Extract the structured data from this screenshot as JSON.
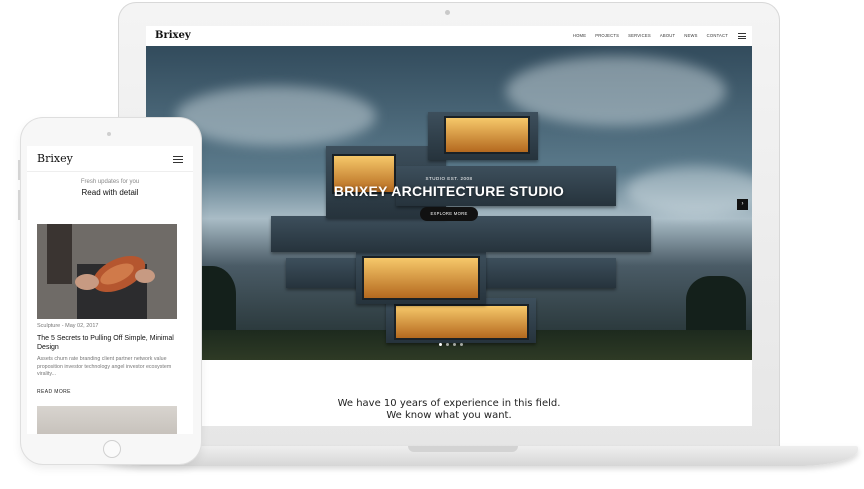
{
  "desktop": {
    "logo": "Brixey",
    "nav": [
      "HOME",
      "PROJECTS",
      "SERVICES",
      "ABOUT",
      "NEWS",
      "CONTACT"
    ],
    "hero": {
      "kicker": "STUDIO EST. 2008",
      "title": "BRIXEY ARCHITECTURE STUDIO",
      "button": "EXPLORE MORE",
      "arrow": "›"
    },
    "tagline_line1": "We have 10 years of experience in this field.",
    "tagline_line2": "We know what you want."
  },
  "mobile": {
    "logo": "Brixey",
    "sub": "Fresh updates for you",
    "heading": "Read with detail",
    "post": {
      "meta": "Sculpture - May 02, 2017",
      "title": "The 5 Secrets to Pulling Off Simple, Minimal Design",
      "excerpt": "Assets churn rate branding client partner network value proposition investor technology angel investor ecosystem virality...",
      "read_more": "READ MORE"
    }
  },
  "colors": {
    "accent": "#111111",
    "window_glow": "#f6c86a",
    "sky": "#5b7a8b"
  },
  "icons": {
    "desktop_menu": "hamburger-icon",
    "mobile_menu": "hamburger-icon",
    "slider_next": "chevron-right-icon"
  }
}
